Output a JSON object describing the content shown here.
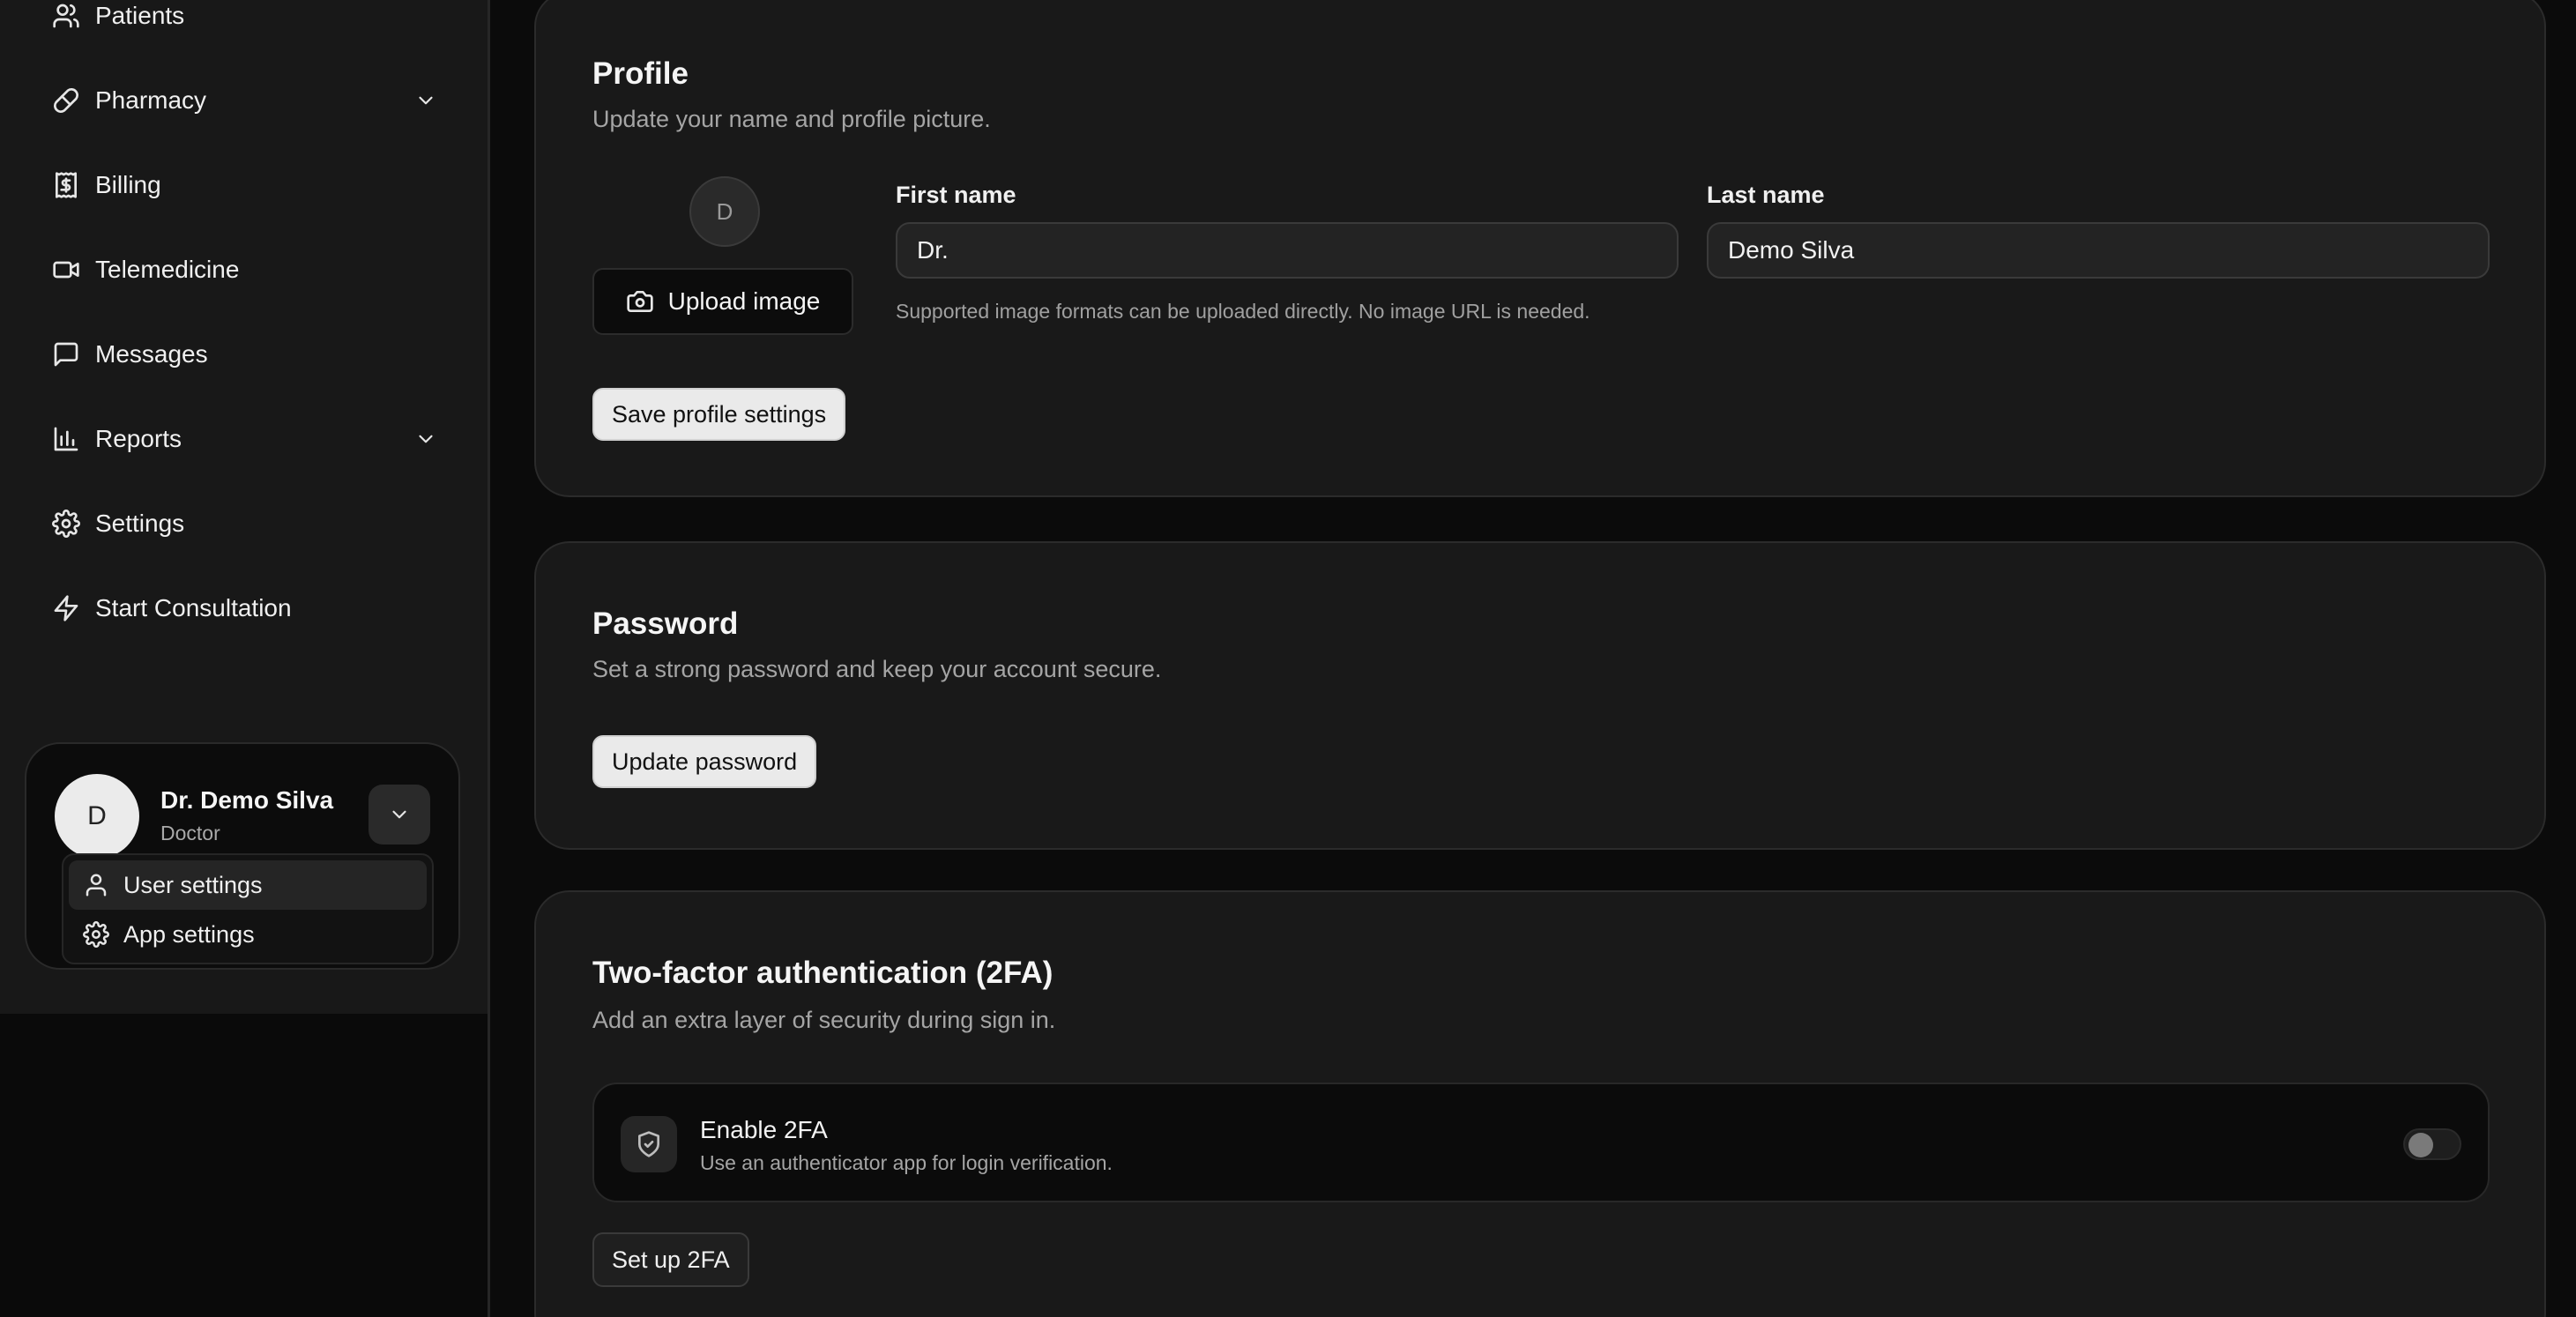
{
  "sidebar": {
    "items": [
      {
        "label": "Patients",
        "icon": "users-icon",
        "has_chevron": false
      },
      {
        "label": "Pharmacy",
        "icon": "pill-icon",
        "has_chevron": true
      },
      {
        "label": "Billing",
        "icon": "receipt-icon",
        "has_chevron": false
      },
      {
        "label": "Telemedicine",
        "icon": "video-icon",
        "has_chevron": false
      },
      {
        "label": "Messages",
        "icon": "message-square-icon",
        "has_chevron": false
      },
      {
        "label": "Reports",
        "icon": "bar-chart-icon",
        "has_chevron": true
      },
      {
        "label": "Settings",
        "icon": "gear-icon",
        "has_chevron": false
      },
      {
        "label": "Start Consultation",
        "icon": "zap-icon",
        "has_chevron": false
      }
    ],
    "user": {
      "initial": "D",
      "name": "Dr. Demo Silva",
      "role": "Doctor",
      "menu": [
        {
          "label": "User settings",
          "icon": "user-icon",
          "active": true
        },
        {
          "label": "App settings",
          "icon": "gear-icon",
          "active": false
        }
      ]
    }
  },
  "profile": {
    "title": "Profile",
    "description": "Update your name and profile picture.",
    "avatar_initial": "D",
    "upload_label": "Upload image",
    "first_name_label": "First name",
    "first_name_value": "Dr.",
    "last_name_label": "Last name",
    "last_name_value": "Demo Silva",
    "hint": "Supported image formats can be uploaded directly. No image URL is needed.",
    "save_label": "Save profile settings"
  },
  "password": {
    "title": "Password",
    "description": "Set a strong password and keep your account secure.",
    "update_label": "Update password"
  },
  "twofa": {
    "title": "Two-factor authentication (2FA)",
    "description": "Add an extra layer of security during sign in.",
    "enable_title": "Enable 2FA",
    "enable_desc": "Use an authenticator app for login verification.",
    "enabled": false,
    "setup_label": "Set up 2FA"
  },
  "colors": {
    "background": "#0b0b0b",
    "sidebar": "#181818",
    "card": "#191919",
    "light_button": "#eaeaea"
  }
}
